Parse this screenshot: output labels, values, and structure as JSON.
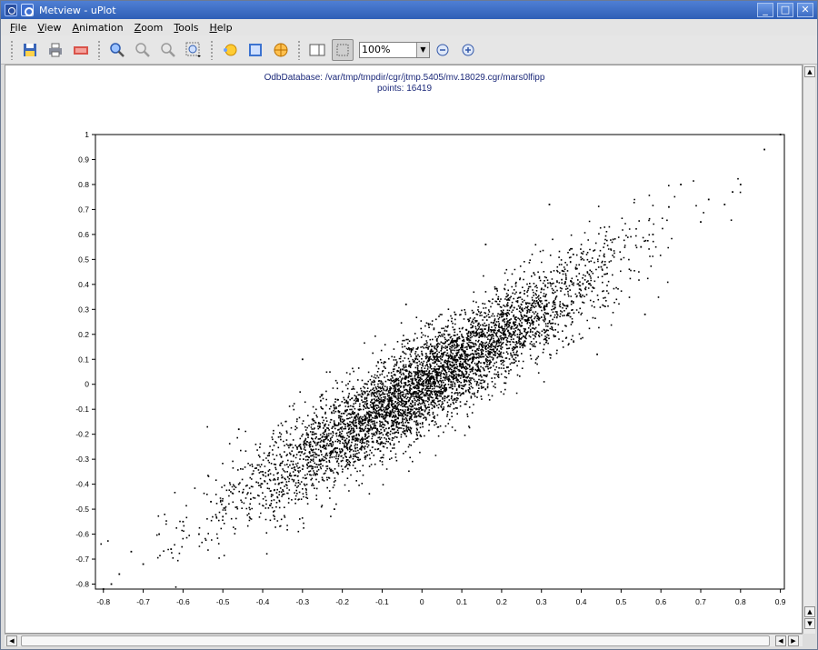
{
  "window": {
    "title": "Metview - uPlot",
    "min_glyph": "_",
    "max_glyph": "□",
    "close_glyph": "✕"
  },
  "menu": [
    {
      "u": "F",
      "rest": "ile"
    },
    {
      "u": "V",
      "rest": "iew"
    },
    {
      "u": "A",
      "rest": "nimation"
    },
    {
      "u": "Z",
      "rest": "oom"
    },
    {
      "u": "T",
      "rest": "ools"
    },
    {
      "u": "H",
      "rest": "elp"
    }
  ],
  "toolbar": {
    "zoom_value": "100%",
    "icons": [
      "save-icon",
      "print-icon",
      "export-icon",
      "zoom-in-icon",
      "zoom-out-icon",
      "zoom-reset-icon",
      "zoom-area-icon",
      "magics-icon",
      "layer-icon",
      "data-icon",
      "sidebar-icon",
      "select-area-icon",
      "zoom-level",
      "zoom-minus-icon",
      "zoom-plus-icon"
    ]
  },
  "plot_header": {
    "line1": "OdbDatabase: /var/tmp/tmpdir/cgr/jtmp.5405/mv.18029.cgr/mars0lfipp",
    "line2": "points: 16419"
  },
  "chart_data": {
    "type": "scatter",
    "title": "",
    "xlabel": "",
    "ylabel": "",
    "xlim": [
      -0.82,
      0.91
    ],
    "ylim": [
      -0.82,
      1.0
    ],
    "xticks": [
      -0.8,
      -0.7,
      -0.6,
      -0.5,
      -0.4,
      -0.3,
      -0.2,
      -0.1,
      0,
      0.1,
      0.2,
      0.3,
      0.4,
      0.5,
      0.6,
      0.7,
      0.8,
      0.9
    ],
    "yticks": [
      -0.8,
      -0.7,
      -0.6,
      -0.5,
      -0.4,
      -0.3,
      -0.2,
      -0.1,
      0,
      0.1,
      0.2,
      0.3,
      0.4,
      0.5,
      0.6,
      0.7,
      0.8,
      0.9,
      1
    ],
    "grid": false,
    "point_count": 16419,
    "marker_color": "#000000",
    "series": [
      {
        "points": [
          [
            0.86,
            0.94
          ],
          [
            0.9,
            1.0
          ],
          [
            0.8,
            0.8
          ],
          [
            0.76,
            0.72
          ],
          [
            0.78,
            0.77
          ],
          [
            0.72,
            0.74
          ],
          [
            0.7,
            0.65
          ],
          [
            0.65,
            0.8
          ],
          [
            0.62,
            0.71
          ],
          [
            0.58,
            0.6
          ],
          [
            0.55,
            0.55
          ],
          [
            0.5,
            0.5
          ],
          [
            0.48,
            0.58
          ],
          [
            0.45,
            0.47
          ],
          [
            0.42,
            0.44
          ],
          [
            0.4,
            0.35
          ],
          [
            0.38,
            0.52
          ],
          [
            0.36,
            0.41
          ],
          [
            0.33,
            0.33
          ],
          [
            0.3,
            0.38
          ],
          [
            0.28,
            0.25
          ],
          [
            0.25,
            0.3
          ],
          [
            0.22,
            0.2
          ],
          [
            0.2,
            0.27
          ],
          [
            0.18,
            0.14
          ],
          [
            0.15,
            0.2
          ],
          [
            0.12,
            0.1
          ],
          [
            0.1,
            0.16
          ],
          [
            0.08,
            0.05
          ],
          [
            0.05,
            0.12
          ],
          [
            0.02,
            0.02
          ],
          [
            0.0,
            0.0
          ],
          [
            -0.02,
            0.05
          ],
          [
            -0.05,
            -0.06
          ],
          [
            -0.08,
            -0.02
          ],
          [
            -0.1,
            -0.12
          ],
          [
            -0.12,
            -0.06
          ],
          [
            -0.15,
            -0.18
          ],
          [
            -0.18,
            -0.12
          ],
          [
            -0.2,
            -0.22
          ],
          [
            -0.22,
            -0.16
          ],
          [
            -0.25,
            -0.3
          ],
          [
            -0.28,
            -0.24
          ],
          [
            -0.3,
            -0.34
          ],
          [
            -0.33,
            -0.28
          ],
          [
            -0.36,
            -0.4
          ],
          [
            -0.4,
            -0.35
          ],
          [
            -0.43,
            -0.46
          ],
          [
            -0.46,
            -0.4
          ],
          [
            -0.5,
            -0.53
          ],
          [
            -0.53,
            -0.47
          ],
          [
            -0.56,
            -0.6
          ],
          [
            -0.6,
            -0.55
          ],
          [
            -0.63,
            -0.66
          ],
          [
            -0.66,
            -0.6
          ],
          [
            -0.7,
            -0.72
          ],
          [
            -0.73,
            -0.67
          ],
          [
            -0.76,
            -0.76
          ],
          [
            -0.78,
            -0.8
          ],
          [
            -0.8,
            -0.82
          ],
          [
            0.32,
            0.72
          ],
          [
            0.16,
            0.56
          ],
          [
            -0.04,
            0.32
          ],
          [
            -0.3,
            0.1
          ],
          [
            0.56,
            0.28
          ],
          [
            0.44,
            0.12
          ],
          [
            -0.22,
            -0.5
          ],
          [
            -0.46,
            -0.18
          ]
        ]
      }
    ],
    "note_rendering": "dense cloud rendered procedurally along y≈x correlation; listed points are representative"
  }
}
